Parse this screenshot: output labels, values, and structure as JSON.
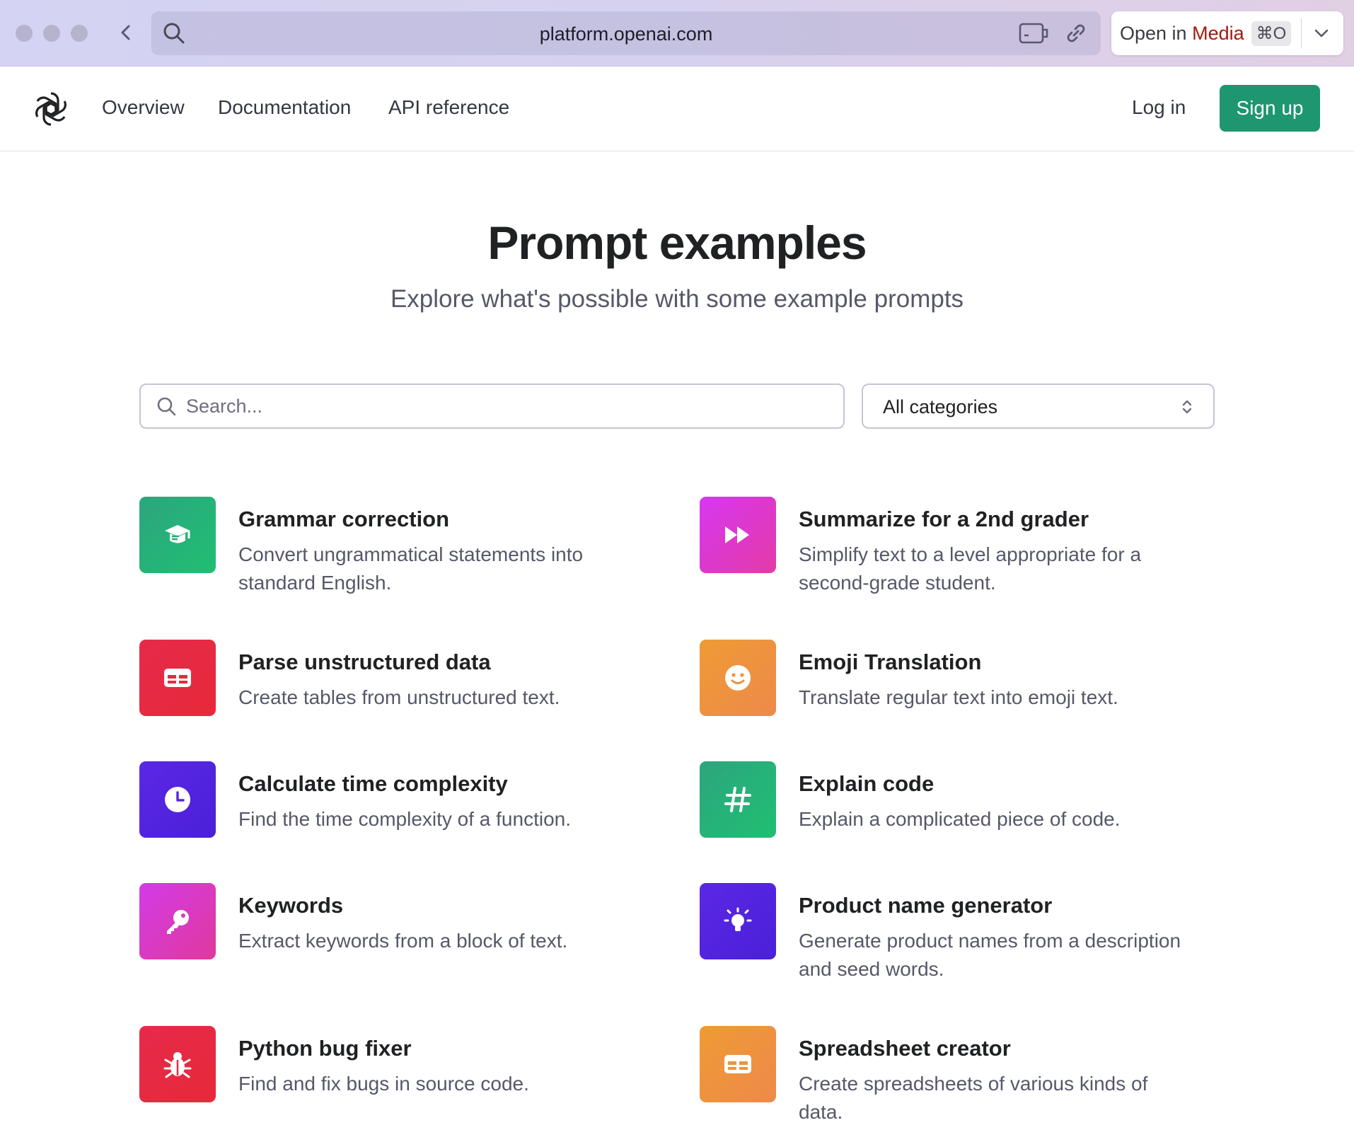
{
  "browser": {
    "url": "platform.openai.com",
    "open_in_prefix": "Open in ",
    "open_in_app": "Media",
    "shortcut": "⌘O"
  },
  "nav": {
    "links": [
      "Overview",
      "Documentation",
      "API reference"
    ],
    "login": "Log in",
    "signup": "Sign up"
  },
  "hero": {
    "title": "Prompt examples",
    "subtitle": "Explore what's possible with some example prompts"
  },
  "search": {
    "placeholder": "Search..."
  },
  "category_select": {
    "selected": "All categories"
  },
  "examples": [
    {
      "title": "Grammar correction",
      "description": "Convert ungrammatical statements into standard English.",
      "icon": "graduation-cap-icon",
      "color": "#21ad76"
    },
    {
      "title": "Summarize for a 2nd grader",
      "description": "Simplify text to a level appropriate for a second-grade student.",
      "icon": "fast-forward-icon",
      "color": "#dd39d0"
    },
    {
      "title": "Parse unstructured data",
      "description": "Create tables from unstructured text.",
      "icon": "table-icon",
      "color": "#e62a43"
    },
    {
      "title": "Emoji Translation",
      "description": "Translate regular text into emoji text.",
      "icon": "smiley-icon",
      "color": "#ee9340"
    },
    {
      "title": "Calculate time complexity",
      "description": "Find the time complexity of a function.",
      "icon": "clock-icon",
      "color": "#5323df"
    },
    {
      "title": "Explain code",
      "description": "Explain a complicated piece of code.",
      "icon": "hashtag-icon",
      "color": "#21ad76"
    },
    {
      "title": "Keywords",
      "description": "Extract keywords from a block of text.",
      "icon": "key-icon",
      "color": "#d93ac3"
    },
    {
      "title": "Product name generator",
      "description": "Generate product names from a description and seed words.",
      "icon": "lightbulb-icon",
      "color": "#5323df"
    },
    {
      "title": "Python bug fixer",
      "description": "Find and fix bugs in source code.",
      "icon": "bug-icon",
      "color": "#e62a43"
    },
    {
      "title": "Spreadsheet creator",
      "description": "Create spreadsheets of various kinds of data.",
      "icon": "table-icon",
      "color": "#ee9340"
    }
  ]
}
